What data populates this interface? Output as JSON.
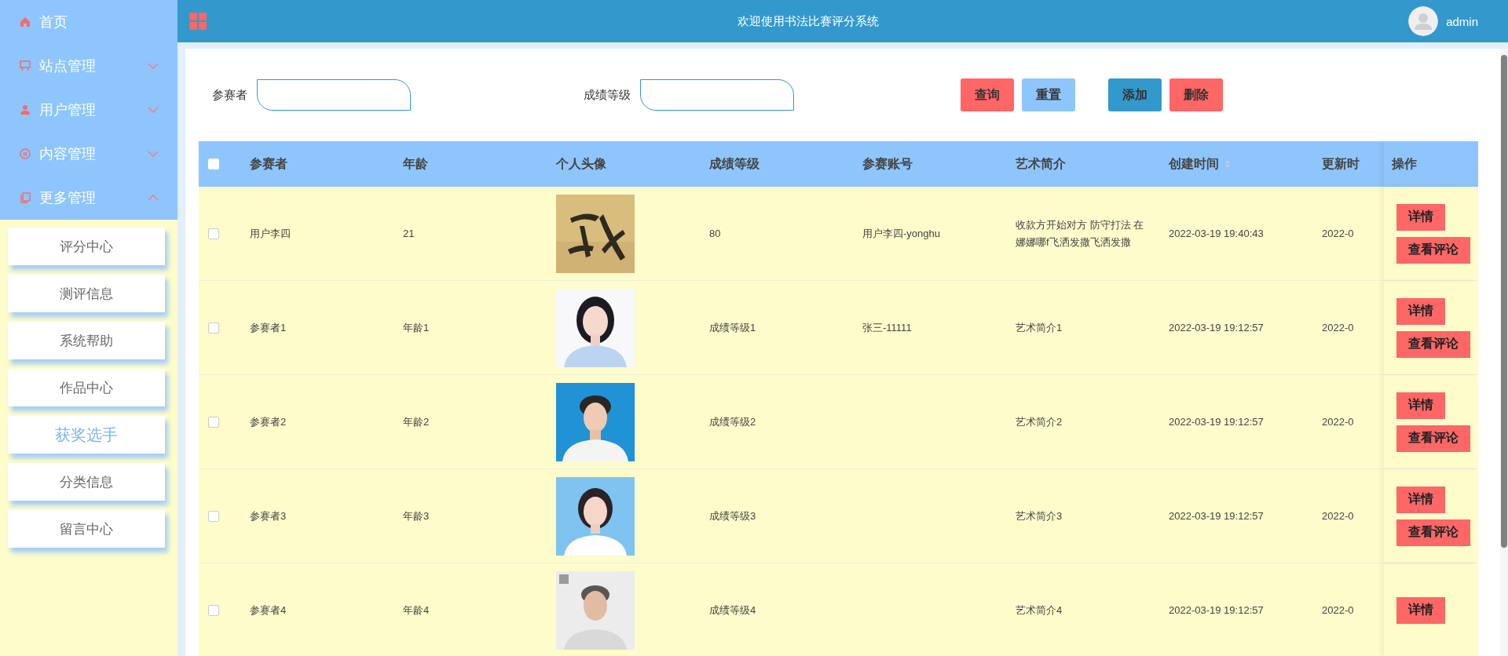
{
  "sidebar": {
    "items": [
      {
        "label": "首页",
        "kind": "link"
      },
      {
        "label": "站点管理",
        "kind": "group",
        "expanded": false
      },
      {
        "label": "用户管理",
        "kind": "group",
        "expanded": false
      },
      {
        "label": "内容管理",
        "kind": "group",
        "expanded": false
      },
      {
        "label": "更多管理",
        "kind": "group",
        "expanded": true,
        "children": [
          {
            "label": "评分中心",
            "selected": false
          },
          {
            "label": "测评信息",
            "selected": false
          },
          {
            "label": "系统帮助",
            "selected": false
          },
          {
            "label": "作品中心",
            "selected": false
          },
          {
            "label": "获奖选手",
            "selected": true
          },
          {
            "label": "分类信息",
            "selected": false
          },
          {
            "label": "留言中心",
            "selected": false
          }
        ]
      }
    ]
  },
  "header": {
    "title": "欢迎使用书法比赛评分系统",
    "user": "admin"
  },
  "filters": [
    {
      "label": "参赛者"
    },
    {
      "label": "成绩等级"
    }
  ],
  "buttons": [
    {
      "label": "查询",
      "kind": "red"
    },
    {
      "label": "重置",
      "kind": "light"
    },
    {
      "label": "添加",
      "kind": "blue"
    },
    {
      "label": "删除",
      "kind": "red"
    }
  ],
  "table": {
    "select_all_checked": false,
    "columns": [
      {
        "label": "参赛者"
      },
      {
        "label": "年龄"
      },
      {
        "label": "个人头像"
      },
      {
        "label": "成绩等级"
      },
      {
        "label": "参赛账号"
      },
      {
        "label": "艺术简介"
      },
      {
        "label": "创建时间",
        "sortable": true
      },
      {
        "label": "更新时"
      }
    ],
    "action_column": "操作",
    "rows": [
      {
        "checked": false,
        "cells": [
          "用户李四",
          "21",
          "",
          "80",
          "用户李四-yonghu",
          "收款方开始对方 防守打法 在娜娜哪f飞洒发撒飞洒发撒",
          "2022-03-19 19:40:43",
          "2022-0"
        ],
        "actions": [
          "详情",
          "查看评论"
        ]
      },
      {
        "checked": false,
        "cells": [
          "参赛者1",
          "年龄1",
          "",
          "成绩等级1",
          "张三-11111",
          "艺术简介1",
          "2022-03-19 19:12:57",
          "2022-0"
        ],
        "actions": [
          "详情",
          "查看评论"
        ]
      },
      {
        "checked": false,
        "cells": [
          "参赛者2",
          "年龄2",
          "",
          "成绩等级2",
          "",
          "艺术简介2",
          "2022-03-19 19:12:57",
          "2022-0"
        ],
        "actions": [
          "详情",
          "查看评论"
        ]
      },
      {
        "checked": false,
        "cells": [
          "参赛者3",
          "年龄3",
          "",
          "成绩等级3",
          "",
          "艺术简介3",
          "2022-03-19 19:12:57",
          "2022-0"
        ],
        "actions": [
          "详情",
          "查看评论"
        ]
      },
      {
        "checked": false,
        "cells": [
          "参赛者4",
          "年龄4",
          "",
          "成绩等级4",
          "",
          "艺术简介4",
          "2022-03-19 19:12:57",
          "2022-0"
        ],
        "actions": [
          "详情"
        ]
      }
    ]
  }
}
